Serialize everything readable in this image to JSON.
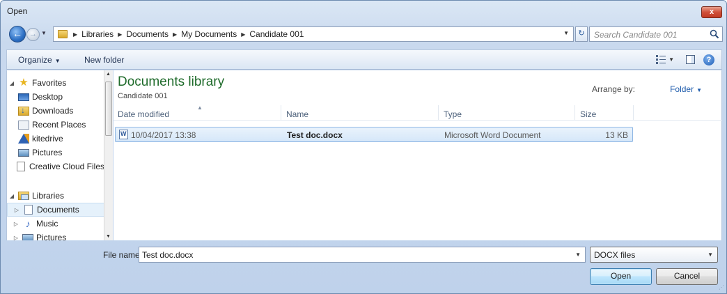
{
  "window": {
    "title": "Open",
    "close_glyph": "x"
  },
  "navigation": {
    "back_glyph": "←",
    "forward_glyph": "→",
    "breadcrumb": [
      "Libraries",
      "Documents",
      "My Documents",
      "Candidate 001"
    ],
    "search_placeholder": "Search Candidate 001"
  },
  "toolbar": {
    "organize": "Organize",
    "new_folder": "New folder",
    "help_glyph": "?"
  },
  "sidebar": {
    "favorites": {
      "label": "Favorites",
      "items": [
        "Desktop",
        "Downloads",
        "Recent Places",
        "kitedrive",
        "Pictures",
        "Creative Cloud Files"
      ]
    },
    "libraries": {
      "label": "Libraries",
      "items": [
        "Documents",
        "Music",
        "Pictures"
      ]
    }
  },
  "content": {
    "library_title": "Documents library",
    "library_subtitle": "Candidate 001",
    "arrange_label": "Arrange by:",
    "arrange_value": "Folder",
    "columns": [
      "Date modified",
      "Name",
      "Type",
      "Size"
    ],
    "files": [
      {
        "date_modified": "10/04/2017 13:38",
        "name": "Test doc.docx",
        "type": "Microsoft Word Document",
        "size": "13 KB"
      }
    ]
  },
  "footer": {
    "file_name_label": "File name:",
    "file_name_value": "Test doc.docx",
    "file_type_value": "DOCX files",
    "open_label": "Open",
    "cancel_label": "Cancel"
  },
  "icons": {
    "favorites": "star-icon",
    "desktop": "desktop-icon",
    "downloads": "downloads-folder-icon",
    "recent": "recent-places-icon",
    "kitedrive": "kitedrive-icon",
    "pictures": "pictures-icon",
    "creative_cloud": "blank-document-icon",
    "libraries": "libraries-icon",
    "documents": "document-icon",
    "music": "music-note-icon",
    "file": "word-document-icon"
  },
  "colors": {
    "library_title": "#1f6b2b",
    "selection": "#d5e7f9",
    "link": "#1c5aab"
  }
}
